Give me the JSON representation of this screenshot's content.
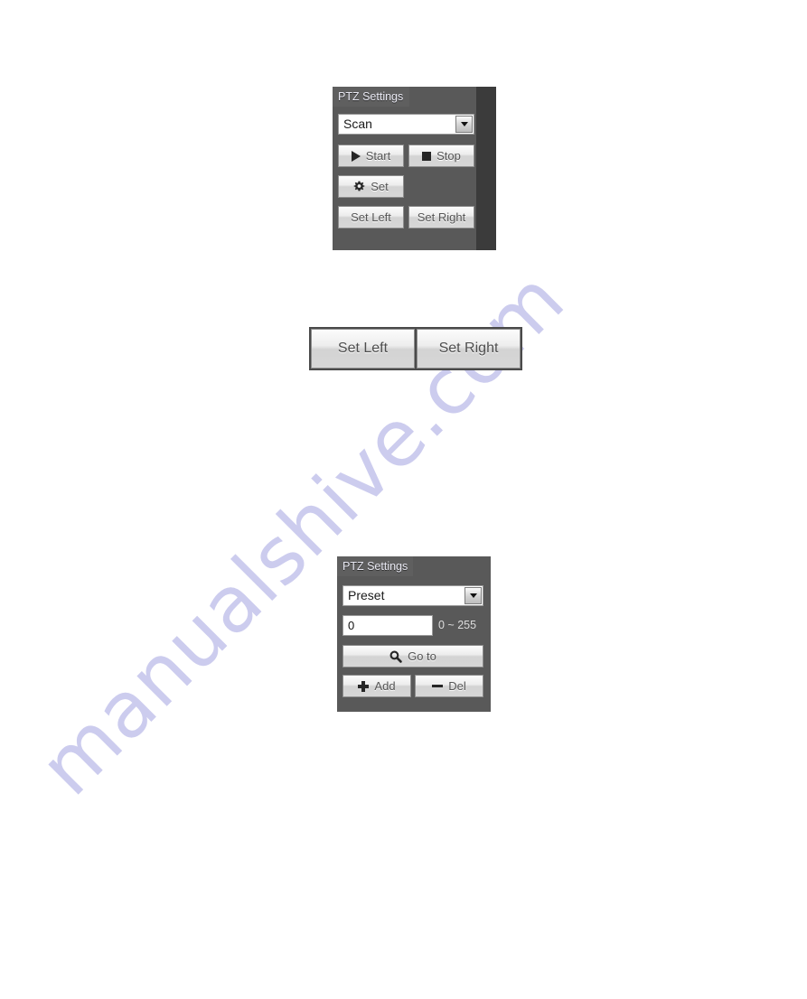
{
  "page": {
    "background_color": "#ffffff",
    "watermark": {
      "text": "manualshive.com",
      "color": "#ccccee"
    }
  },
  "panel_scan": {
    "title": "PTZ Settings",
    "mode_select": {
      "value": "Scan",
      "arrow_icon": "chevron-down-icon"
    },
    "buttons": {
      "start": {
        "label": "Start",
        "icon": "play-icon"
      },
      "stop": {
        "label": "Stop",
        "icon": "stop-square-icon"
      },
      "set": {
        "label": "Set",
        "icon": "gear-icon"
      },
      "set_left": {
        "label": "Set Left"
      },
      "set_right": {
        "label": "Set Right"
      }
    }
  },
  "standalone_buttons": {
    "set_left": "Set Left",
    "set_right": "Set Right"
  },
  "panel_preset": {
    "title": "PTZ Settings",
    "mode_select": {
      "value": "Preset",
      "arrow_icon": "chevron-down-icon"
    },
    "preset_field": {
      "value": "0",
      "placeholder": "0",
      "range_label": "0 ~ 255"
    },
    "buttons": {
      "goto": {
        "label": "Go to",
        "icon": "magnifier-icon"
      },
      "add": {
        "label": "Add",
        "icon": "plus-icon"
      },
      "del": {
        "label": "Del",
        "icon": "minus-icon"
      }
    }
  }
}
